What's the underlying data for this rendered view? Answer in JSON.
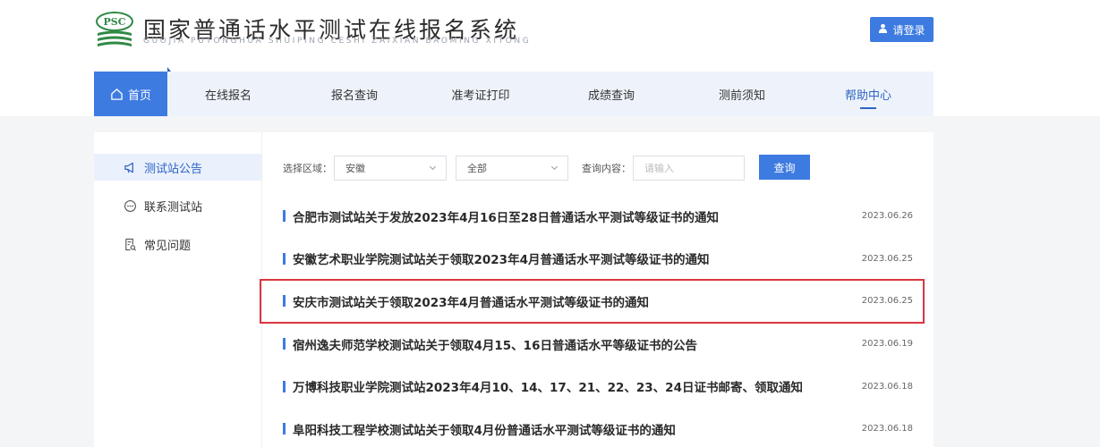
{
  "header": {
    "logo_text": "PSC",
    "title": "国家普通话水平测试在线报名系统",
    "subtitle": "GUOJIA PUTONGHUA SHUIPING CESHI ZAIXIAN BAOMING XITONG",
    "login_label": "请登录"
  },
  "nav": {
    "items": [
      {
        "label": "首页"
      },
      {
        "label": "在线报名"
      },
      {
        "label": "报名查询"
      },
      {
        "label": "准考证打印"
      },
      {
        "label": "成绩查询"
      },
      {
        "label": "测前须知"
      },
      {
        "label": "帮助中心"
      }
    ]
  },
  "sidebar": {
    "items": [
      {
        "label": "测试站公告",
        "icon": "megaphone-icon"
      },
      {
        "label": "联系测试站",
        "icon": "chat-icon"
      },
      {
        "label": "常见问题",
        "icon": "document-search-icon"
      }
    ]
  },
  "filters": {
    "region_label": "选择区域：",
    "region_value": "安徽",
    "scope_value": "全部",
    "query_label": "查询内容：",
    "query_placeholder": "请输入",
    "query_button": "查询"
  },
  "notices": [
    {
      "title": "合肥市测试站关于发放2023年4月16日至28日普通话水平测试等级证书的通知",
      "date": "2023.06.26"
    },
    {
      "title": "安徽艺术职业学院测试站关于领取2023年4月普通话水平测试等级证书的通知",
      "date": "2023.06.25"
    },
    {
      "title": "安庆市测试站关于领取2023年4月普通话水平测试等级证书的通知",
      "date": "2023.06.25"
    },
    {
      "title": "宿州逸夫师范学校测试站关于领取4月15、16日普通话水平等级证书的公告",
      "date": "2023.06.19"
    },
    {
      "title": "万博科技职业学院测试站2023年4月10、14、17、21、22、23、24日证书邮寄、领取通知",
      "date": "2023.06.18"
    },
    {
      "title": "阜阳科技工程学校测试站关于领取4月份普通话水平测试等级证书的通知",
      "date": "2023.06.18"
    }
  ],
  "colors": {
    "accent": "#3d7be1",
    "highlight_border": "#d9363e",
    "logo_green": "#2f8a45"
  }
}
